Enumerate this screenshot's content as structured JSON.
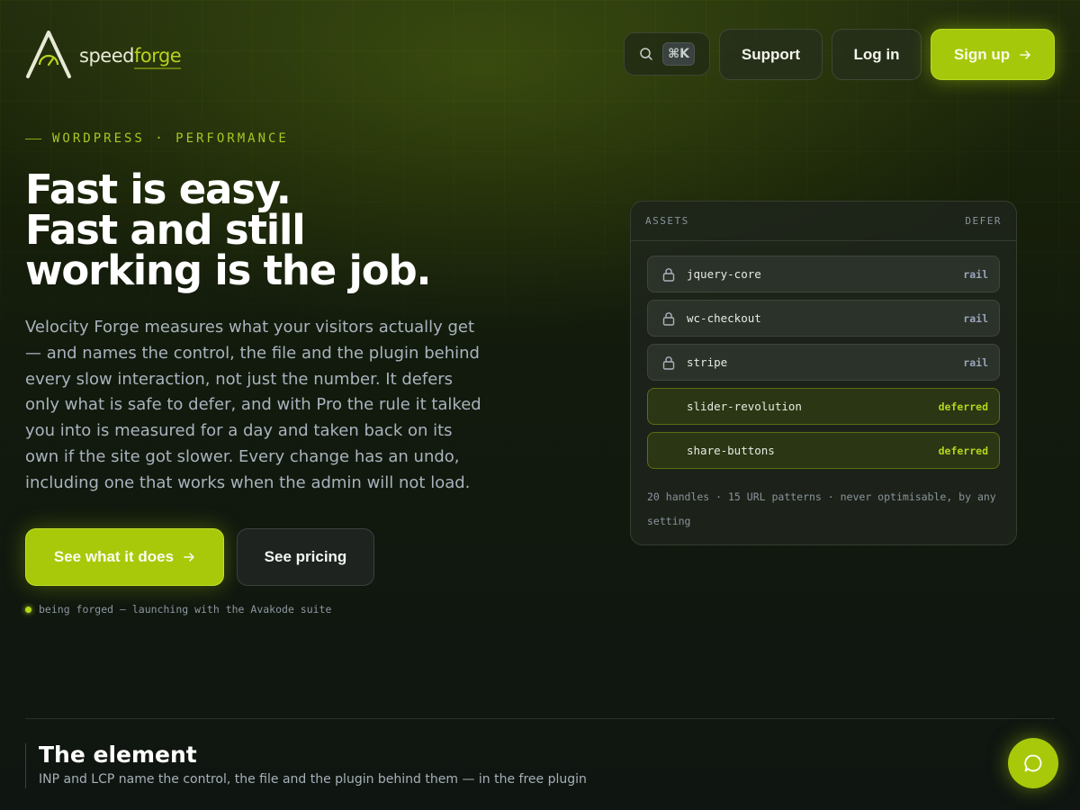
{
  "brand": {
    "name_part1": "speed",
    "name_part2": "forge"
  },
  "nav": {
    "search_icon": "search-icon",
    "shortcut": "⌘K",
    "support": "Support",
    "login": "Log in",
    "signup": "Sign up"
  },
  "hero": {
    "eyebrow": "WORDPRESS · PERFORMANCE",
    "headline": [
      "Fast is easy.",
      "Fast and still",
      "working is the job."
    ],
    "lead": "Velocity Forge measures what your visitors actually get — and names the control, the file and the plugin behind every slow interaction, not just the number. It defers only what is safe to defer, and with Pro the rule it talked you into is measured for a day and taken back on its own if the site got slower. Every change has an undo, including one that works when the admin will not load.",
    "cta_primary": "See what it does",
    "cta_secondary": "See pricing",
    "status": "being forged — launching with the Avakode suite"
  },
  "assets_panel": {
    "header_left": "ASSETS",
    "header_right": "DEFER",
    "rows": [
      {
        "name": "jquery-core",
        "status": "rail",
        "locked": true
      },
      {
        "name": "wc-checkout",
        "status": "rail",
        "locked": true
      },
      {
        "name": "stripe",
        "status": "rail",
        "locked": true
      },
      {
        "name": "slider-revolution",
        "status": "deferred",
        "locked": false
      },
      {
        "name": "share-buttons",
        "status": "deferred",
        "locked": false
      }
    ],
    "footer": "20 handles · 15 URL patterns · never optimisable, by any setting"
  },
  "feature": {
    "title": "The element",
    "subtitle": "INP and LCP name the control, the file and the plugin behind them — in the free plugin"
  },
  "colors": {
    "accent": "#a8c90a",
    "background": "#121a0d",
    "muted_text": "#a9b3bd"
  }
}
